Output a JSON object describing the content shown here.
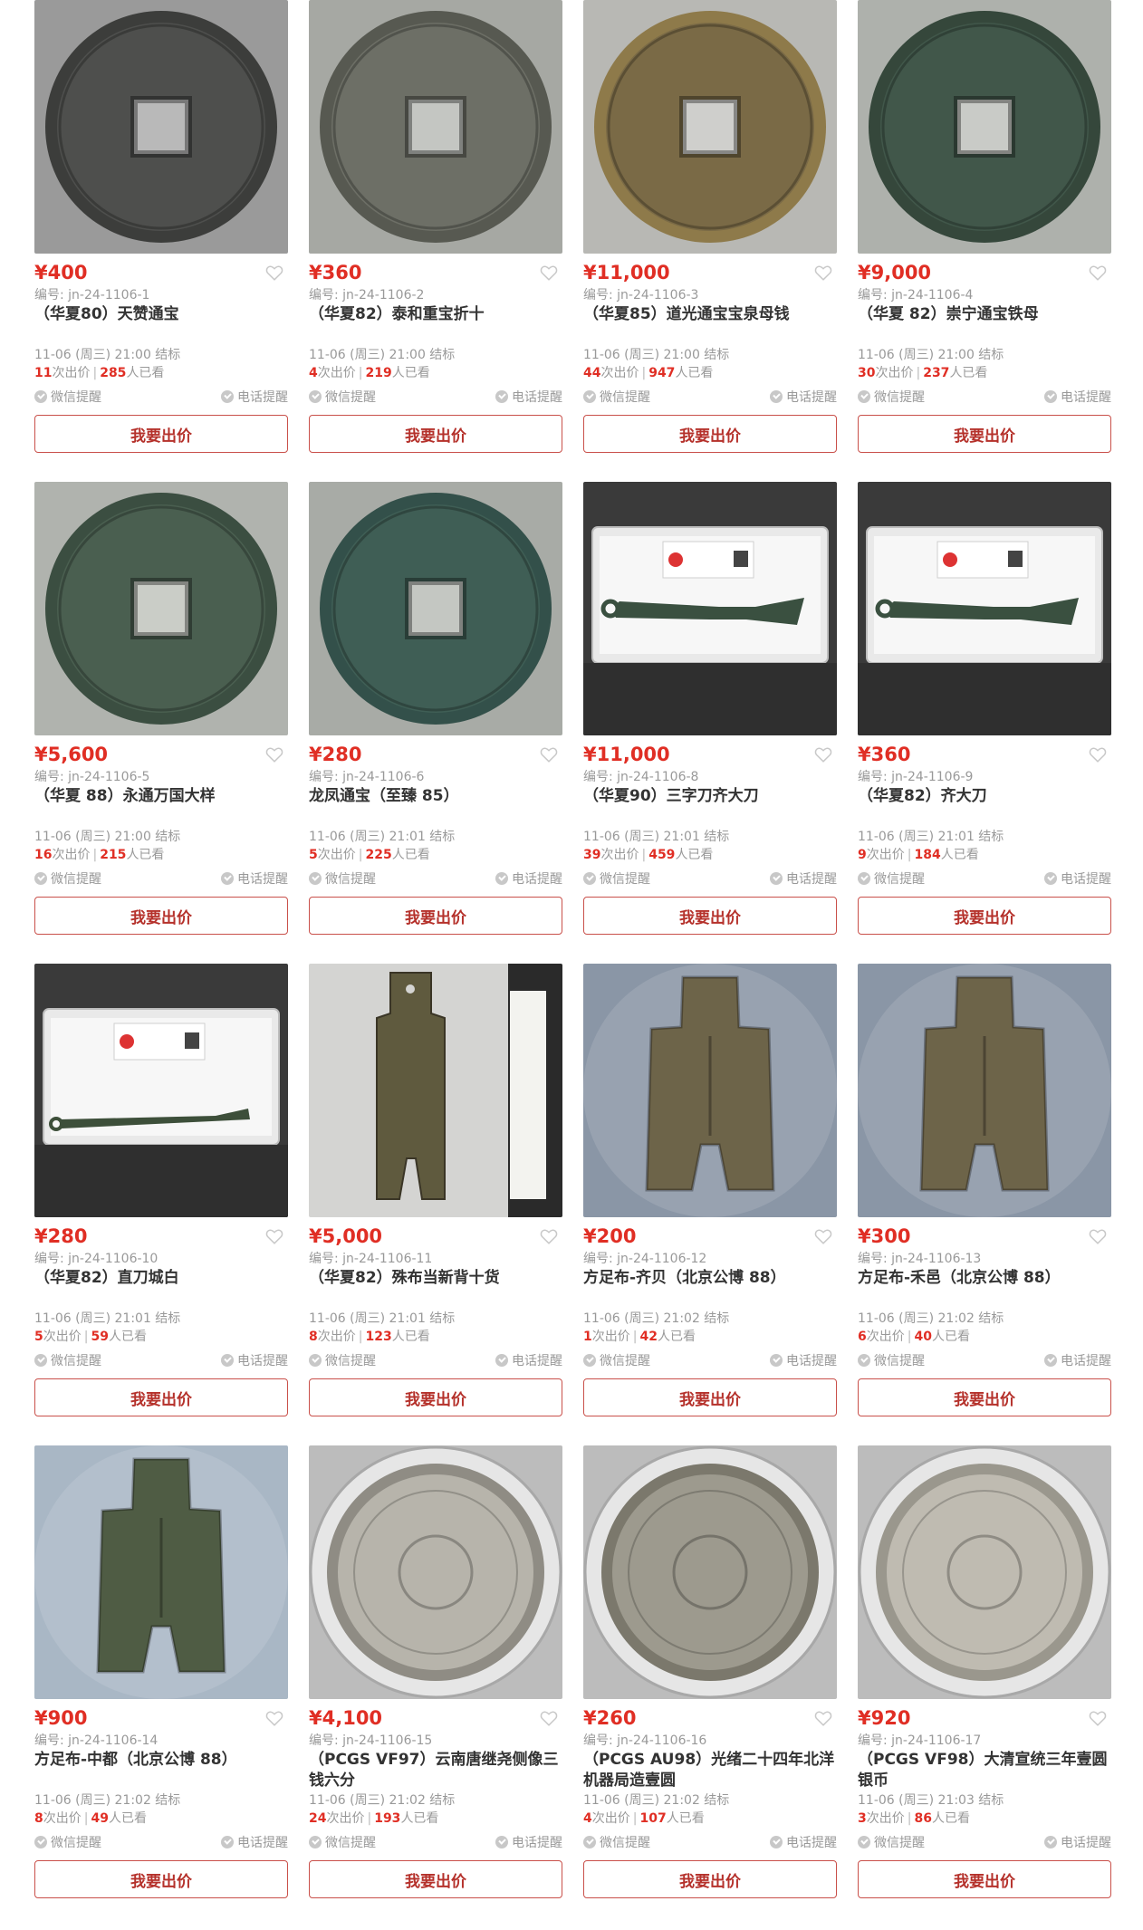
{
  "colors": {
    "price": "#e02e24",
    "button_border": "#c9504a",
    "muted": "#999999"
  },
  "ui": {
    "wechat_label": "微信提醒",
    "phone_label": "电话提醒",
    "bid_label": "我要出价",
    "count_suffix": "次出价",
    "views_suffix": "人已看",
    "currency": "¥"
  },
  "lots": [
    {
      "price": "¥400",
      "code": "编号: jn-24-1106-1",
      "title": "（华夏80）天赞通宝",
      "end": "11-06 (周三) 21:00 结标",
      "bids": "11",
      "views": "285",
      "img": "coin-dark"
    },
    {
      "price": "¥360",
      "code": "编号: jn-24-1106-2",
      "title": "（华夏82）泰和重宝折十",
      "end": "11-06 (周三) 21:00 结标",
      "bids": "4",
      "views": "219",
      "img": "coin-grey"
    },
    {
      "price": "¥11,000",
      "code": "编号: jn-24-1106-3",
      "title": "（华夏85）道光通宝宝泉母钱",
      "end": "11-06 (周三) 21:00 结标",
      "bids": "44",
      "views": "947",
      "img": "coin-bronze"
    },
    {
      "price": "¥9,000",
      "code": "编号: jn-24-1106-4",
      "title": "（华夏 82）崇宁通宝铁母",
      "end": "11-06 (周三) 21:00 结标",
      "bids": "30",
      "views": "237",
      "img": "coin-green"
    },
    {
      "price": "¥5,600",
      "code": "编号: jn-24-1106-5",
      "title": "（华夏 88）永通万国大样",
      "end": "11-06 (周三) 21:00 结标",
      "bids": "16",
      "views": "215",
      "img": "coin-green2"
    },
    {
      "price": "¥280",
      "code": "编号: jn-24-1106-6",
      "title": "龙凤通宝（至臻 85）",
      "end": "11-06 (周三) 21:01 结标",
      "bids": "5",
      "views": "225",
      "img": "coin-green3"
    },
    {
      "price": "¥11,000",
      "code": "编号: jn-24-1106-8",
      "title": "（华夏90）三字刀齐大刀",
      "end": "11-06 (周三) 21:01 结标",
      "bids": "39",
      "views": "459",
      "img": "knife"
    },
    {
      "price": "¥360",
      "code": "编号: jn-24-1106-9",
      "title": "（华夏82）齐大刀",
      "end": "11-06 (周三) 21:01 结标",
      "bids": "9",
      "views": "184",
      "img": "knife"
    },
    {
      "price": "¥280",
      "code": "编号: jn-24-1106-10",
      "title": "（华夏82）直刀城白",
      "end": "11-06 (周三) 21:01 结标",
      "bids": "5",
      "views": "59",
      "img": "knife-straight"
    },
    {
      "price": "¥5,000",
      "code": "编号: jn-24-1106-11",
      "title": "（华夏82）殊布当新背十货",
      "end": "11-06 (周三) 21:01 结标",
      "bids": "8",
      "views": "123",
      "img": "long-spade"
    },
    {
      "price": "¥200",
      "code": "编号: jn-24-1106-12",
      "title": "方足布-齐贝（北京公博 88）",
      "end": "11-06 (周三) 21:02 结标",
      "bids": "1",
      "views": "42",
      "img": "spade"
    },
    {
      "price": "¥300",
      "code": "编号: jn-24-1106-13",
      "title": "方足布-禾邑（北京公博 88）",
      "end": "11-06 (周三) 21:02 结标",
      "bids": "6",
      "views": "40",
      "img": "spade"
    },
    {
      "price": "¥900",
      "code": "编号: jn-24-1106-14",
      "title": "方足布-中都（北京公博 88）",
      "end": "11-06 (周三) 21:02 结标",
      "bids": "8",
      "views": "49",
      "img": "spade-green"
    },
    {
      "price": "¥4,100",
      "code": "编号: jn-24-1106-15",
      "title": "（PCGS VF97）云南唐继尧侧像三钱六分",
      "end": "11-06 (周三) 21:02 结标",
      "bids": "24",
      "views": "193",
      "img": "silver-flags"
    },
    {
      "price": "¥260",
      "code": "编号: jn-24-1106-16",
      "title": "（PCGS AU98）光绪二十四年北洋机器局造壹圆",
      "end": "11-06 (周三) 21:02 结标",
      "bids": "4",
      "views": "107",
      "img": "silver-dark"
    },
    {
      "price": "¥920",
      "code": "编号: jn-24-1106-17",
      "title": "（PCGS VF98）大清宣统三年壹圆银币",
      "end": "11-06 (周三) 21:03 结标",
      "bids": "3",
      "views": "86",
      "img": "silver-dragon"
    }
  ]
}
